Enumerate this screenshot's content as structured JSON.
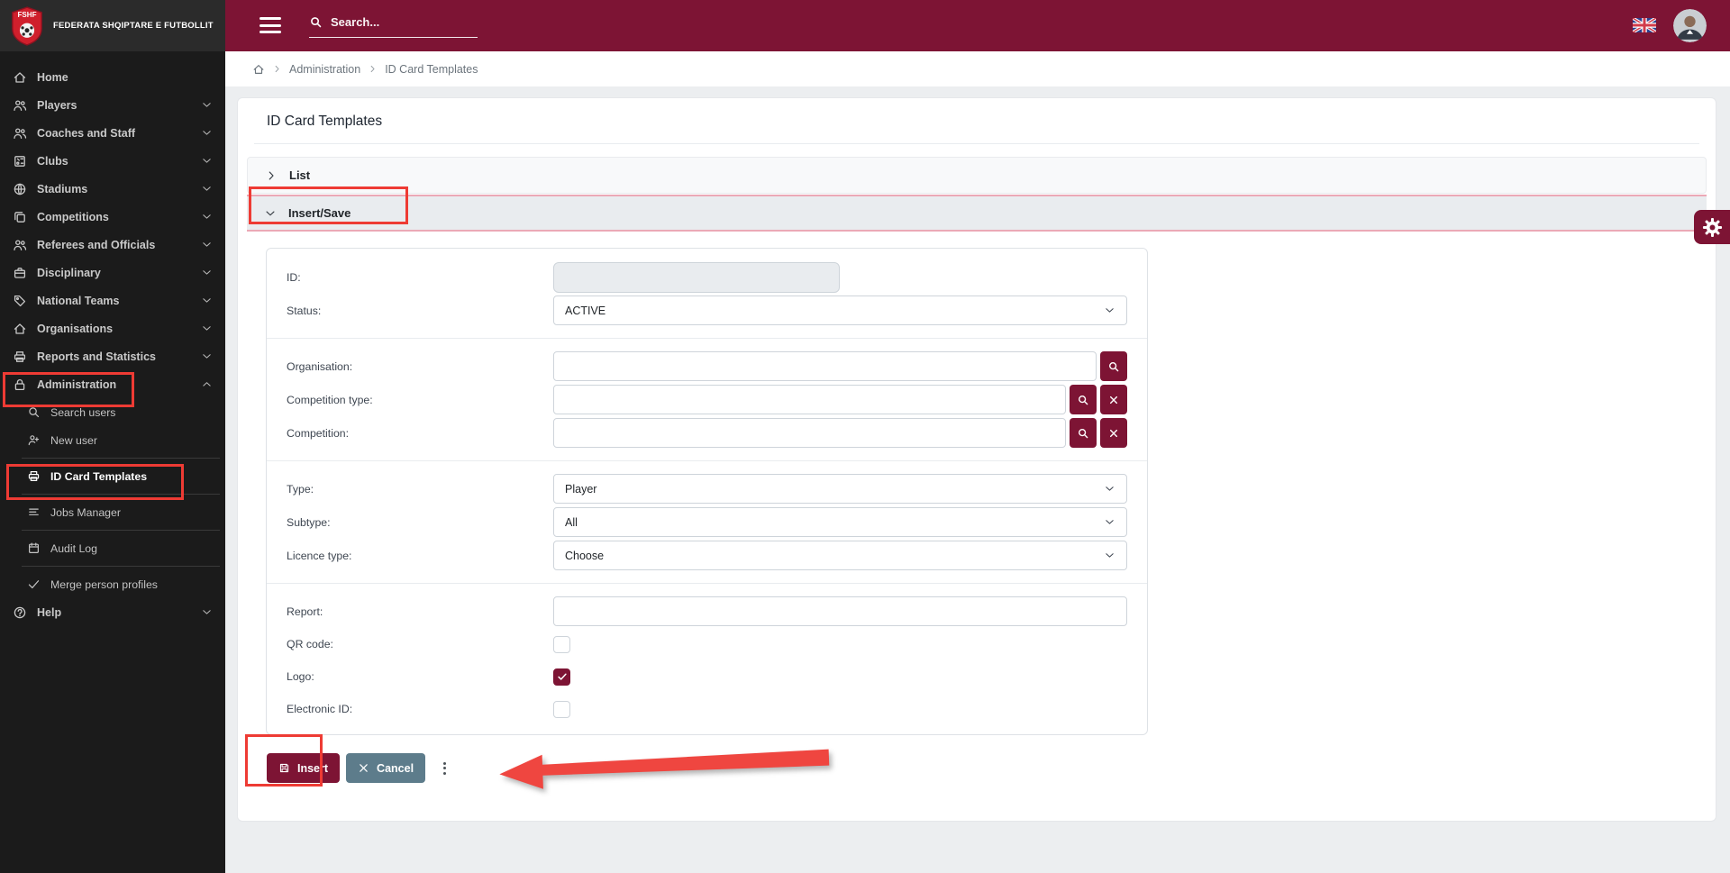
{
  "brand": {
    "abbr": "FSHF",
    "name": "FEDERATA SHQIPTARE E FUTBOLLIT"
  },
  "topbar": {
    "search_placeholder": "Search..."
  },
  "breadcrumb": {
    "items": [
      "Administration",
      "ID Card Templates"
    ]
  },
  "page": {
    "title": "ID Card Templates"
  },
  "sections": {
    "list": "List",
    "insert_save": "Insert/Save"
  },
  "sidebar": {
    "items": [
      {
        "label": "Home"
      },
      {
        "label": "Players"
      },
      {
        "label": "Coaches and Staff"
      },
      {
        "label": "Clubs"
      },
      {
        "label": "Stadiums"
      },
      {
        "label": "Competitions"
      },
      {
        "label": "Referees and Officials"
      },
      {
        "label": "Disciplinary"
      },
      {
        "label": "National Teams"
      },
      {
        "label": "Organisations"
      },
      {
        "label": "Reports and Statistics"
      },
      {
        "label": "Administration"
      },
      {
        "label": "Help"
      }
    ],
    "admin_children": [
      {
        "label": "Search users"
      },
      {
        "label": "New user"
      },
      {
        "label": "ID Card Templates"
      },
      {
        "label": "Jobs Manager"
      },
      {
        "label": "Audit Log"
      },
      {
        "label": "Merge person profiles"
      }
    ]
  },
  "form": {
    "id": {
      "label": "ID:",
      "value": ""
    },
    "status": {
      "label": "Status:",
      "value": "ACTIVE"
    },
    "organisation": {
      "label": "Organisation:",
      "value": ""
    },
    "competition_type": {
      "label": "Competition type:",
      "value": ""
    },
    "competition": {
      "label": "Competition:",
      "value": ""
    },
    "type": {
      "label": "Type:",
      "value": "Player"
    },
    "subtype": {
      "label": "Subtype:",
      "value": "All"
    },
    "licence_type": {
      "label": "Licence type:",
      "value": "Choose"
    },
    "report": {
      "label": "Report:",
      "value": ""
    },
    "qr_code": {
      "label": "QR code:",
      "checked": false
    },
    "logo": {
      "label": "Logo:",
      "checked": true
    },
    "electronic_id": {
      "label": "Electronic ID:",
      "checked": false
    }
  },
  "actions": {
    "insert": "Insert",
    "cancel": "Cancel"
  },
  "colors": {
    "accent": "#7d1434",
    "annotation": "#ee3b34",
    "cancel": "#5d7c8b",
    "insert_save_border": "#eba9b6"
  }
}
